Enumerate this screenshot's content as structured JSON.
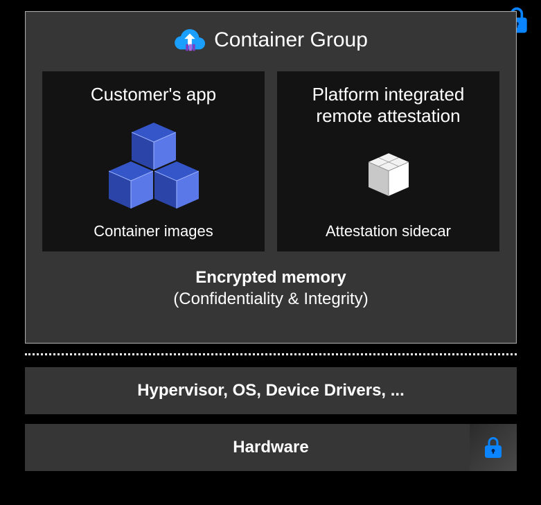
{
  "containerGroup": {
    "title": "Container Group",
    "cards": [
      {
        "title": "Customer's app",
        "footer": "Container images"
      },
      {
        "title": "Platform integrated\nremote attestation",
        "footer": "Attestation sidecar"
      }
    ],
    "encryptedMemory": {
      "title": "Encrypted memory",
      "subtitle": "(Confidentiality & Integrity)"
    }
  },
  "layers": {
    "hypervisor": "Hypervisor, OS, Device Drivers, ...",
    "hardware": "Hardware"
  },
  "colors": {
    "accent": "#0a84ff",
    "boxBlue": "#4a6ff0",
    "boxWhite": "#ffffff"
  }
}
